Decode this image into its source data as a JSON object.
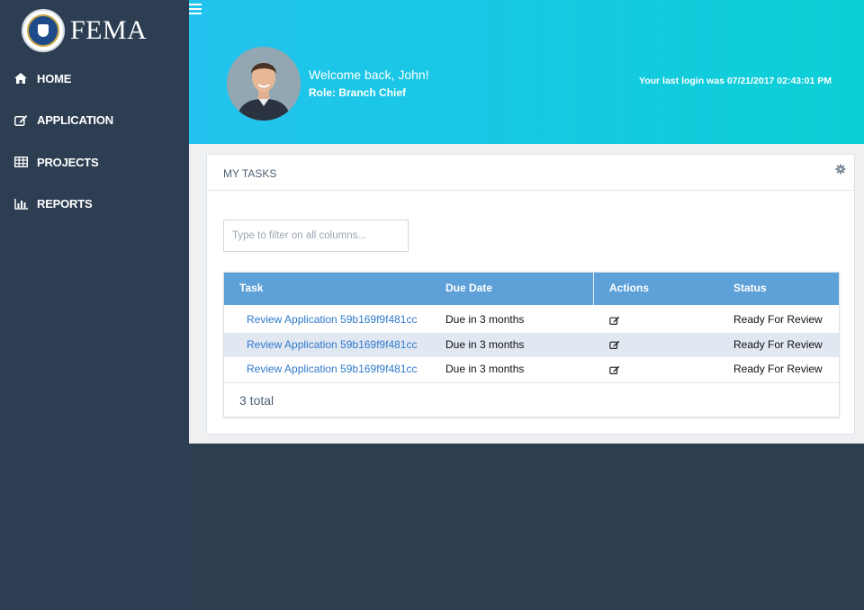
{
  "brand": {
    "name": "FEMA"
  },
  "nav": {
    "items": [
      {
        "label": "HOME",
        "icon": "home-icon"
      },
      {
        "label": "APPLICATION",
        "icon": "edit-icon"
      },
      {
        "label": "PROJECTS",
        "icon": "table-icon"
      },
      {
        "label": "REPORTS",
        "icon": "bar-chart-icon"
      }
    ]
  },
  "header": {
    "welcome": "Welcome back, John!",
    "role": "Role: Branch Chief",
    "last_login": "Your last login was 07/21/2017 02:43:01 PM"
  },
  "tasks": {
    "title": "MY TASKS",
    "filter_placeholder": "Type to filter on all columns...",
    "columns": [
      "Task",
      "Due Date",
      "Actions",
      "Status"
    ],
    "rows": [
      {
        "task": "Review Application 59b169f9f481cc",
        "due": "Due in 3 months",
        "action_icon": "edit-icon",
        "status": "Ready For Review"
      },
      {
        "task": "Review Application 59b169f9f481cc",
        "due": "Due in 3 months",
        "action_icon": "edit-icon",
        "status": "Ready For Review"
      },
      {
        "task": "Review Application 59b169f9f481cc",
        "due": "Due in 3 months",
        "action_icon": "edit-icon",
        "status": "Ready For Review"
      }
    ],
    "total": "3 total"
  },
  "colors": {
    "sidebar": "#2d3e52",
    "header_from": "#22c3ee",
    "header_to": "#0ccfd6",
    "grid_header": "#5ea0d8",
    "link": "#2f7acb",
    "row_alt": "#e2e8f2"
  }
}
